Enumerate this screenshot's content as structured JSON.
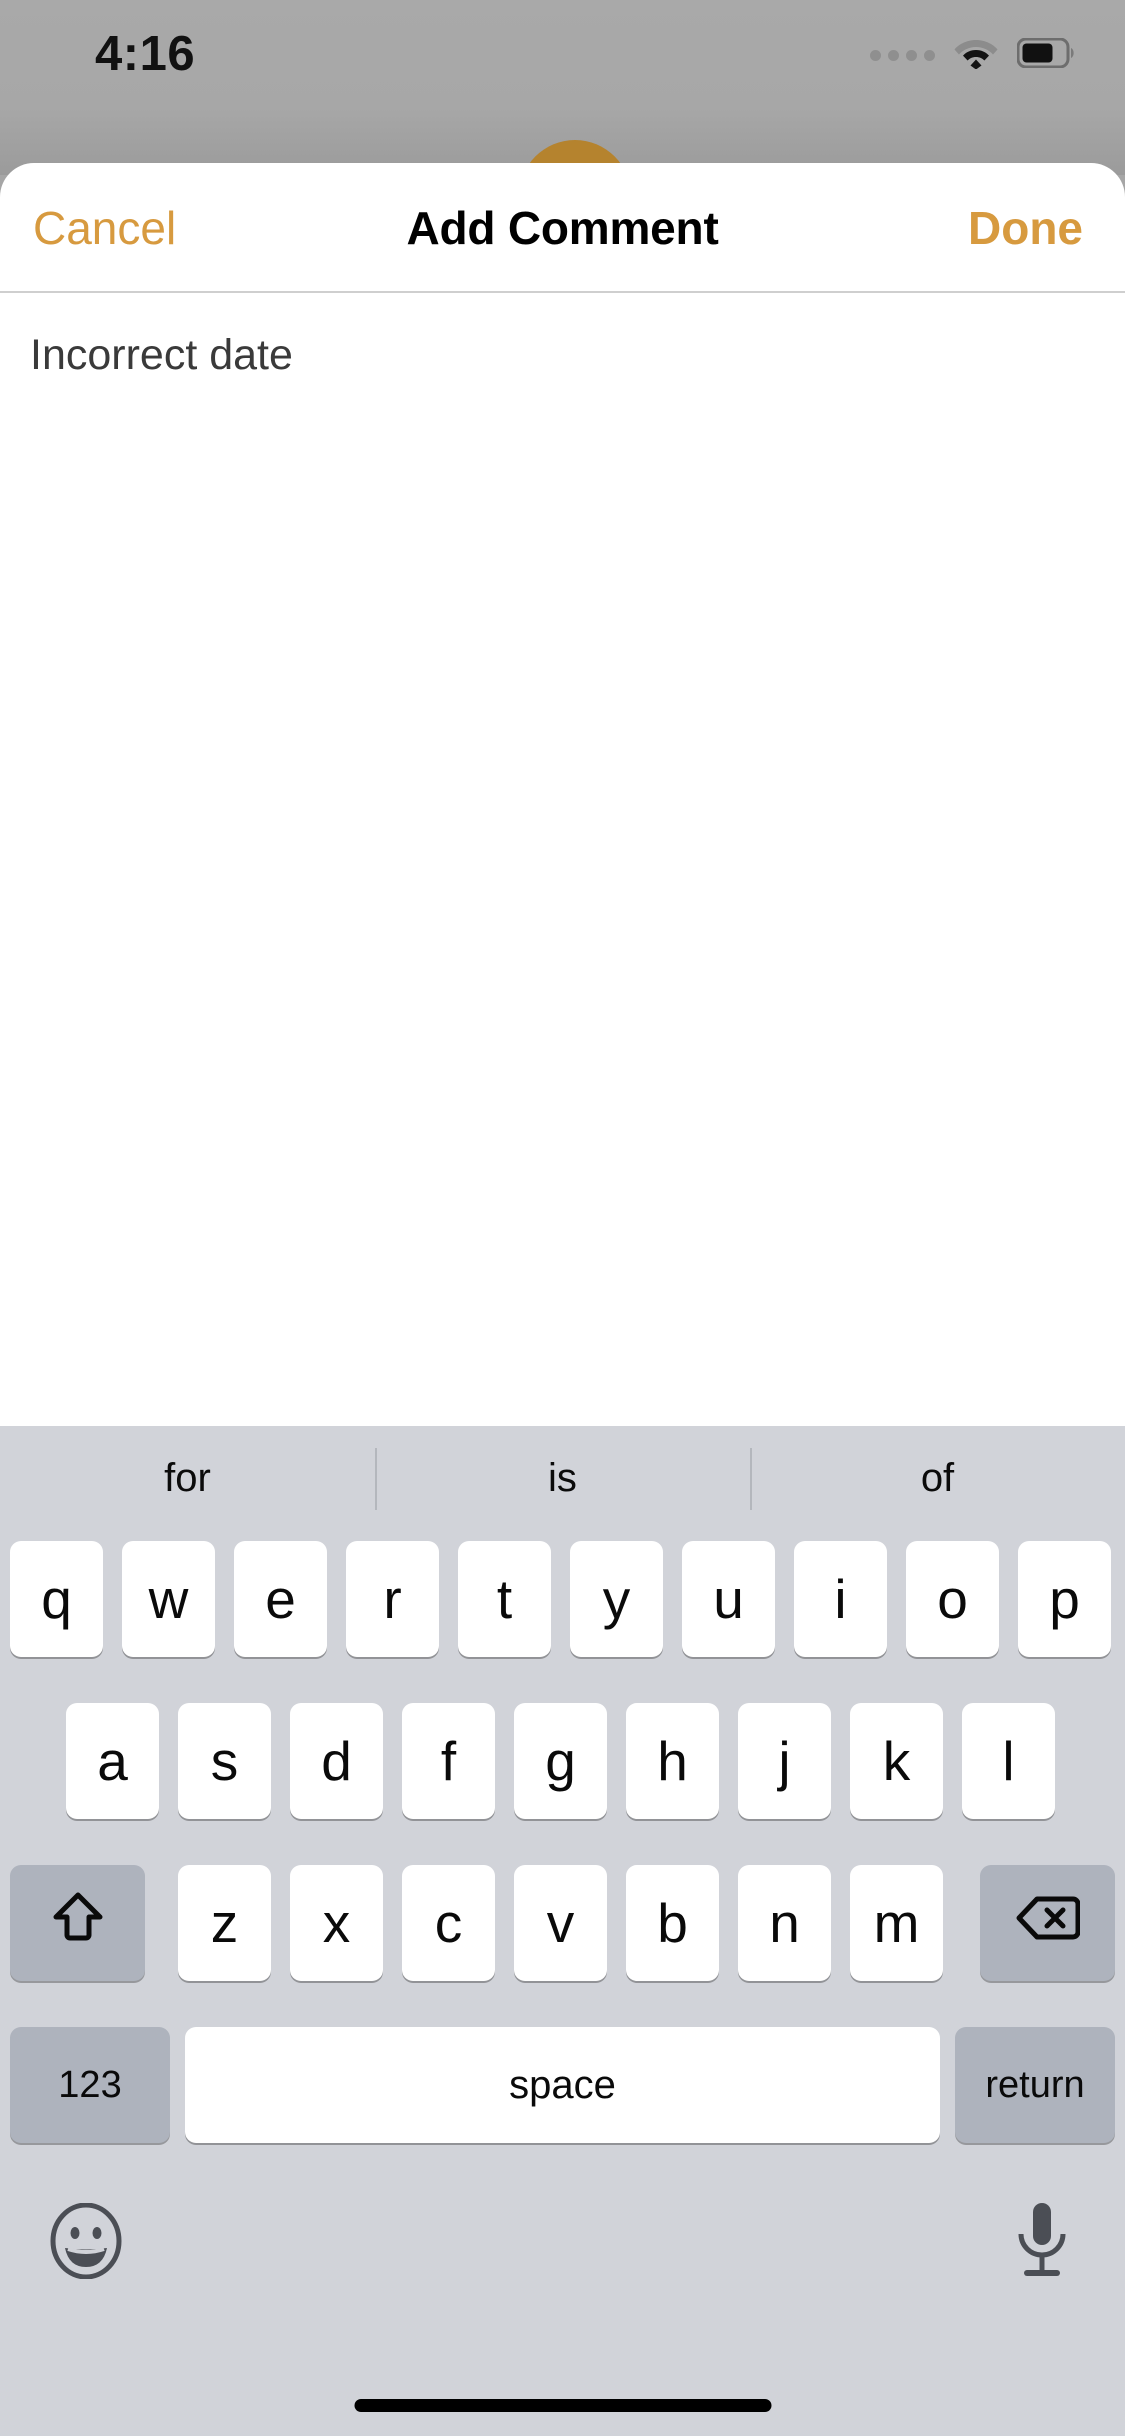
{
  "status_bar": {
    "time": "4:16",
    "signal_icon": "signal-dots-icon",
    "wifi_icon": "wifi-icon",
    "battery_icon": "battery-icon",
    "battery_level_percent": 65
  },
  "sheet": {
    "navbar": {
      "cancel_label": "Cancel",
      "title": "Add Comment",
      "done_label": "Done",
      "accent_color": "#d79a3f"
    },
    "comment": {
      "value": "Incorrect date",
      "placeholder": ""
    }
  },
  "keyboard": {
    "suggestions": [
      "for",
      "is",
      "of"
    ],
    "row1": [
      "q",
      "w",
      "e",
      "r",
      "t",
      "y",
      "u",
      "i",
      "o",
      "p"
    ],
    "row2": [
      "a",
      "s",
      "d",
      "f",
      "g",
      "h",
      "j",
      "k",
      "l"
    ],
    "row3": [
      "z",
      "x",
      "c",
      "v",
      "b",
      "n",
      "m"
    ],
    "shift_icon": "shift-arrow-icon",
    "delete_icon": "backspace-icon",
    "numeric_label": "123",
    "space_label": "space",
    "return_label": "return",
    "emoji_icon": "emoji-smiley-icon",
    "mic_icon": "microphone-icon",
    "background_color": "#d1d3d9",
    "key_color": "#ffffff",
    "modifier_key_color": "#aeb3bd"
  }
}
